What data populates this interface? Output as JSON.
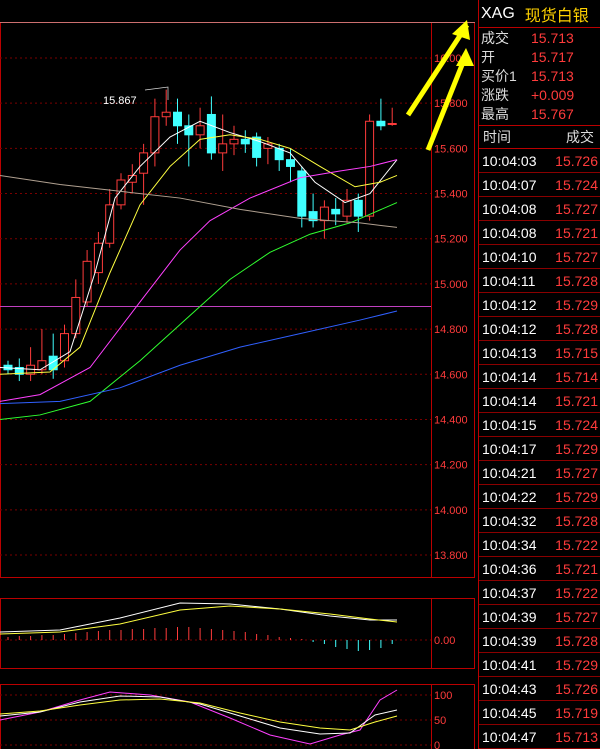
{
  "header": {
    "symbol": "XAG",
    "name": "现货白银"
  },
  "quote": [
    {
      "label": "成交",
      "value": "15.713"
    },
    {
      "label": "开",
      "value": "15.717"
    },
    {
      "label": "买价1",
      "value": "15.713"
    },
    {
      "label": "涨跌",
      "value": "+0.009"
    },
    {
      "label": "最高",
      "value": "15.767"
    }
  ],
  "ticks_header": {
    "time": "时间",
    "price": "成交"
  },
  "ticks": [
    {
      "time": "10:04:03",
      "price": "15.726"
    },
    {
      "time": "10:04:07",
      "price": "15.724"
    },
    {
      "time": "10:04:08",
      "price": "15.727"
    },
    {
      "time": "10:04:08",
      "price": "15.721"
    },
    {
      "time": "10:04:10",
      "price": "15.727"
    },
    {
      "time": "10:04:11",
      "price": "15.728"
    },
    {
      "time": "10:04:12",
      "price": "15.729"
    },
    {
      "time": "10:04:12",
      "price": "15.728"
    },
    {
      "time": "10:04:13",
      "price": "15.715"
    },
    {
      "time": "10:04:14",
      "price": "15.714"
    },
    {
      "time": "10:04:14",
      "price": "15.721"
    },
    {
      "time": "10:04:15",
      "price": "15.724"
    },
    {
      "time": "10:04:17",
      "price": "15.729"
    },
    {
      "time": "10:04:21",
      "price": "15.727"
    },
    {
      "time": "10:04:22",
      "price": "15.729"
    },
    {
      "time": "10:04:32",
      "price": "15.728"
    },
    {
      "time": "10:04:34",
      "price": "15.722"
    },
    {
      "time": "10:04:36",
      "price": "15.721"
    },
    {
      "time": "10:04:37",
      "price": "15.722"
    },
    {
      "time": "10:04:39",
      "price": "15.727"
    },
    {
      "time": "10:04:39",
      "price": "15.728"
    },
    {
      "time": "10:04:41",
      "price": "15.729"
    },
    {
      "time": "10:04:43",
      "price": "15.726"
    },
    {
      "time": "10:04:45",
      "price": "15.719"
    },
    {
      "time": "10:04:47",
      "price": "15.713"
    }
  ],
  "chart": {
    "price_axis": [
      "16.000",
      "15.800",
      "15.600",
      "15.400",
      "15.200",
      "15.000",
      "14.800",
      "14.600",
      "14.400",
      "14.200",
      "14.000",
      "13.800"
    ],
    "high_marker": "15.867",
    "macd_axis": [
      "0.00"
    ],
    "kdj_axis": [
      "100",
      "50",
      "0"
    ],
    "colors": {
      "up": "#ff3b3b",
      "down": "#40ffff",
      "ma5": "#ffffff",
      "ma10": "#ffff40",
      "ma20": "#ff40ff",
      "ma40": "#30ff30",
      "ma60": "#3060ff",
      "arrow": "#ffff00"
    }
  }
}
